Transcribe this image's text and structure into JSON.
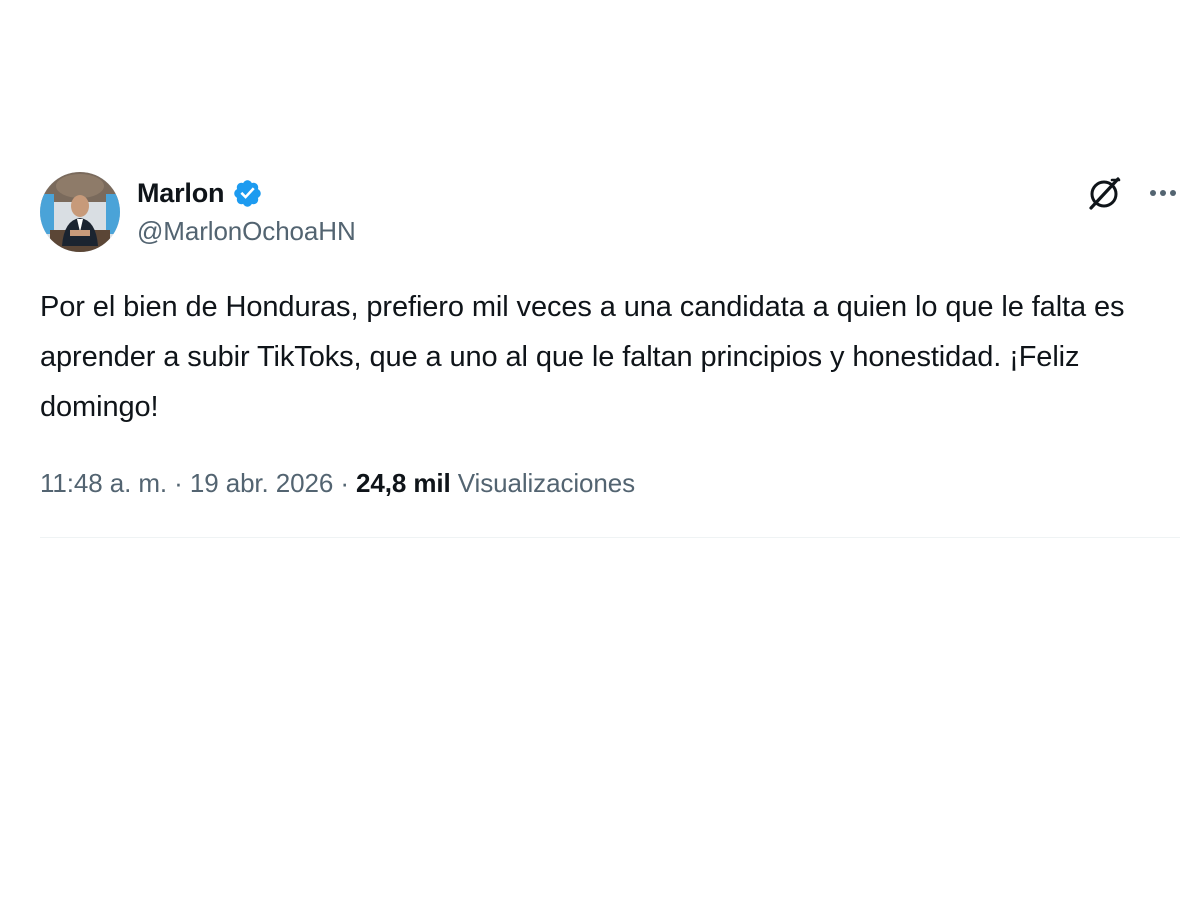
{
  "author": {
    "display_name": "Marlon",
    "handle": "@MarlonOchoaHN",
    "verified_badge_color": "#1d9bf0"
  },
  "tweet": {
    "text": "Por el bien de Honduras, prefiero mil veces a una candidata a quien lo que le falta es aprender a subir TikToks, que a uno al que le faltan principios y honestidad. ¡Feliz domingo!",
    "time": "11:48 a. m.",
    "separator": " · ",
    "date": "19 abr. 2026",
    "views_count": "24,8 mil",
    "views_label": "Visualizaciones"
  },
  "icons": {
    "grok": "grok-icon",
    "more": "more-options-icon",
    "verified": "verified-badge-icon"
  }
}
